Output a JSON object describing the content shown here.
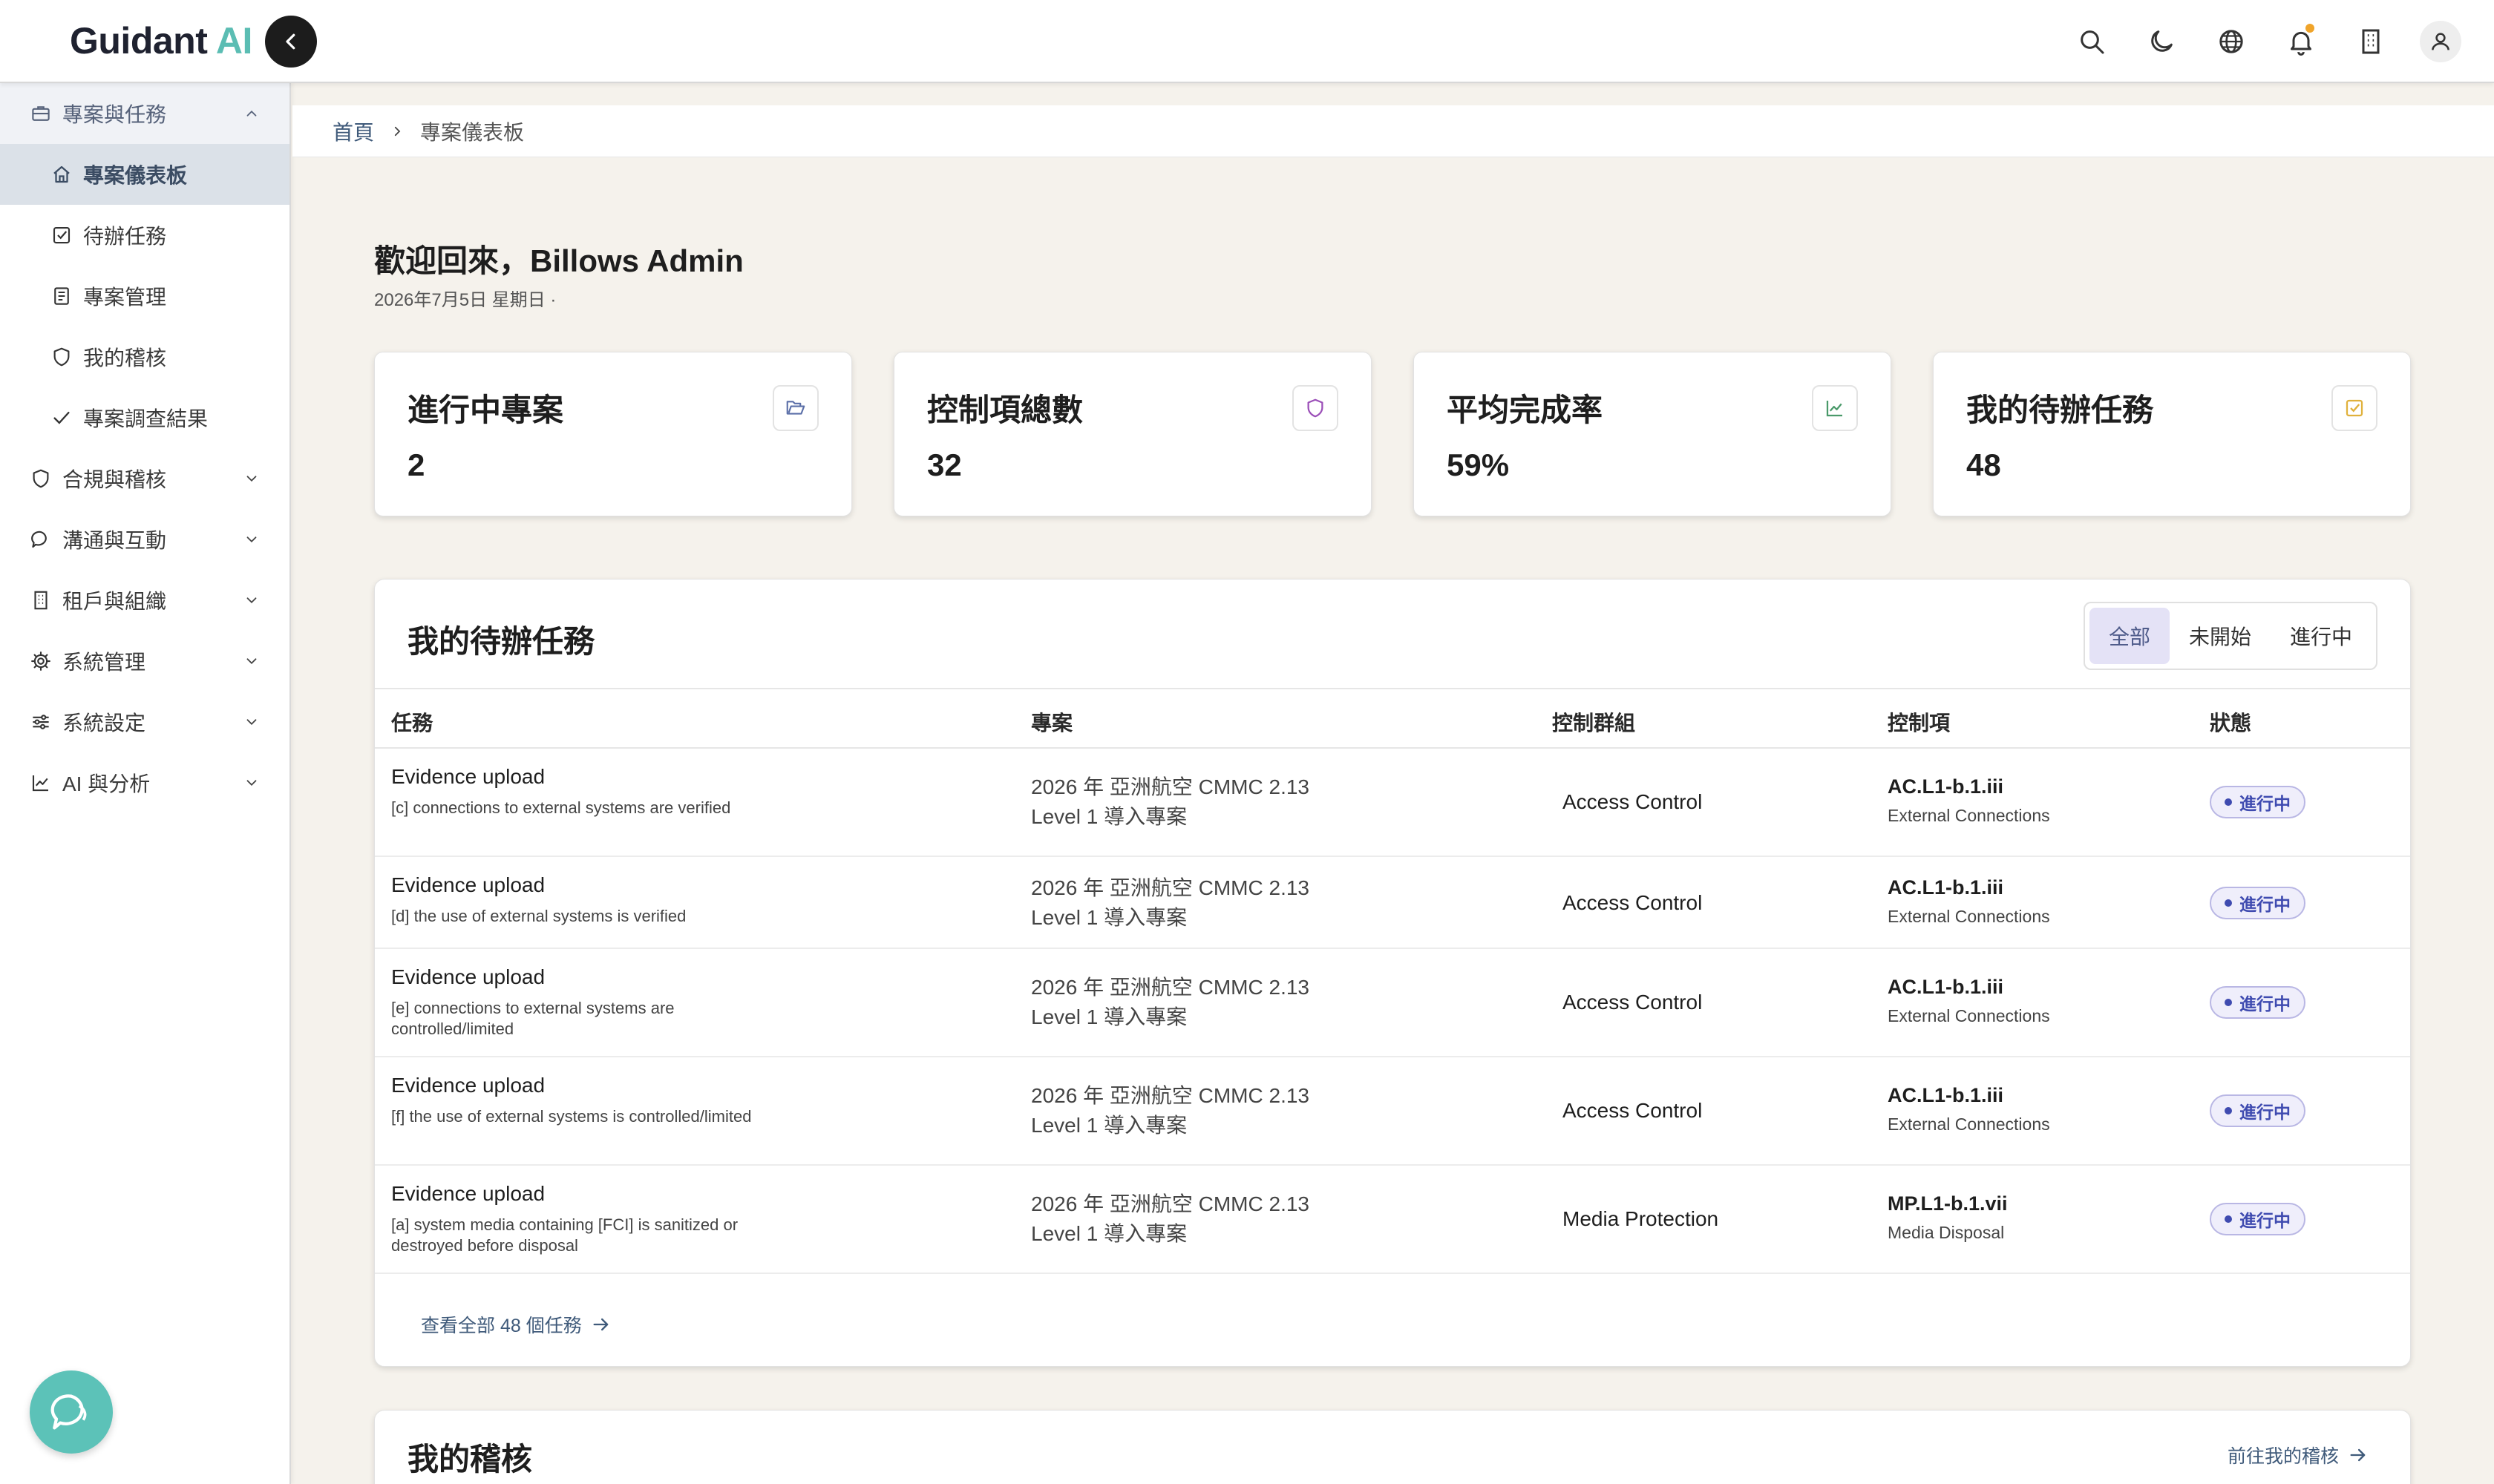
{
  "brand": {
    "name": "Guidant",
    "accent": "AI",
    "accent_color": "#5bbdb3"
  },
  "topbar": {
    "icons": [
      "search-icon",
      "moon-icon",
      "globe-icon",
      "bell-icon",
      "building-icon",
      "user-icon"
    ],
    "notification_dot_color": "#f0a42a"
  },
  "sidebar": {
    "groups": [
      {
        "label": "專案與任務",
        "icon": "briefcase-icon",
        "open": true,
        "items": [
          {
            "label": "專案儀表板",
            "icon": "home-icon",
            "active": true
          },
          {
            "label": "待辦任務",
            "icon": "checkbox-icon"
          },
          {
            "label": "專案管理",
            "icon": "document-icon"
          },
          {
            "label": "我的稽核",
            "icon": "shield-icon"
          },
          {
            "label": "專案調查結果",
            "icon": "check-icon"
          }
        ]
      },
      {
        "label": "合規與稽核",
        "icon": "shield-icon"
      },
      {
        "label": "溝通與互動",
        "icon": "chat-icon"
      },
      {
        "label": "租戶與組織",
        "icon": "building-icon"
      },
      {
        "label": "系統管理",
        "icon": "gear-icon"
      },
      {
        "label": "系統設定",
        "icon": "sliders-icon"
      },
      {
        "label": "AI 與分析",
        "icon": "chart-icon"
      }
    ]
  },
  "breadcrumb": {
    "home": "首頁",
    "current": "專案儀表板"
  },
  "welcome": {
    "title": "歡迎回來，Billows Admin",
    "date": "2026年7月5日 星期日 ·"
  },
  "stats": [
    {
      "title": "進行中專案",
      "value": "2",
      "icon": "folder-icon",
      "icon_color": "#5b6fa8"
    },
    {
      "title": "控制項總數",
      "value": "32",
      "icon": "shield-icon",
      "icon_color": "#9b4fb8"
    },
    {
      "title": "平均完成率",
      "value": "59%",
      "icon": "trend-icon",
      "icon_color": "#4a9a6a"
    },
    {
      "title": "我的待辦任務",
      "value": "48",
      "icon": "task-icon",
      "icon_color": "#e0b13c"
    }
  ],
  "tasks": {
    "title": "我的待辦任務",
    "filters": [
      "全部",
      "未開始",
      "進行中"
    ],
    "active_filter": "全部",
    "columns": [
      "任務",
      "專案",
      "控制群組",
      "控制項",
      "狀態"
    ],
    "rows": [
      {
        "title": "Evidence upload",
        "desc": "[c] connections to external systems are verified",
        "project": [
          "2026 年 亞洲航空 CMMC 2.13",
          "Level 1 導入專案"
        ],
        "group": "Access Control",
        "code": "AC.L1-b.1.iii",
        "control": "External Connections",
        "status": "進行中"
      },
      {
        "title": "Evidence upload",
        "desc": "[d] the use of external systems is verified",
        "project": [
          "2026 年 亞洲航空 CMMC 2.13",
          "Level 1 導入專案"
        ],
        "group": "Access Control",
        "code": "AC.L1-b.1.iii",
        "control": "External Connections",
        "status": "進行中"
      },
      {
        "title": "Evidence upload",
        "desc": "[e] connections to external systems are controlled/limited",
        "project": [
          "2026 年 亞洲航空 CMMC 2.13",
          "Level 1 導入專案"
        ],
        "group": "Access Control",
        "code": "AC.L1-b.1.iii",
        "control": "External Connections",
        "status": "進行中"
      },
      {
        "title": "Evidence upload",
        "desc": "[f] the use of external systems is controlled/limited",
        "project": [
          "2026 年 亞洲航空 CMMC 2.13",
          "Level 1 導入專案"
        ],
        "group": "Access Control",
        "code": "AC.L1-b.1.iii",
        "control": "External Connections",
        "status": "進行中"
      },
      {
        "title": "Evidence upload",
        "desc": "[a] system media containing [FCI] is sanitized or destroyed before disposal",
        "project": [
          "2026 年 亞洲航空 CMMC 2.13",
          "Level 1 導入專案"
        ],
        "group": "Media Protection",
        "code": "MP.L1-b.1.vii",
        "control": "Media Disposal",
        "status": "進行中"
      }
    ],
    "view_all": "查看全部 48 個任務"
  },
  "audit": {
    "title": "我的稽核",
    "link": "前往我的稽核"
  },
  "colors": {
    "badge": "#3f4bb0",
    "active_nav": "#dbe1e8",
    "chat_fab": "#5cc2b8"
  }
}
